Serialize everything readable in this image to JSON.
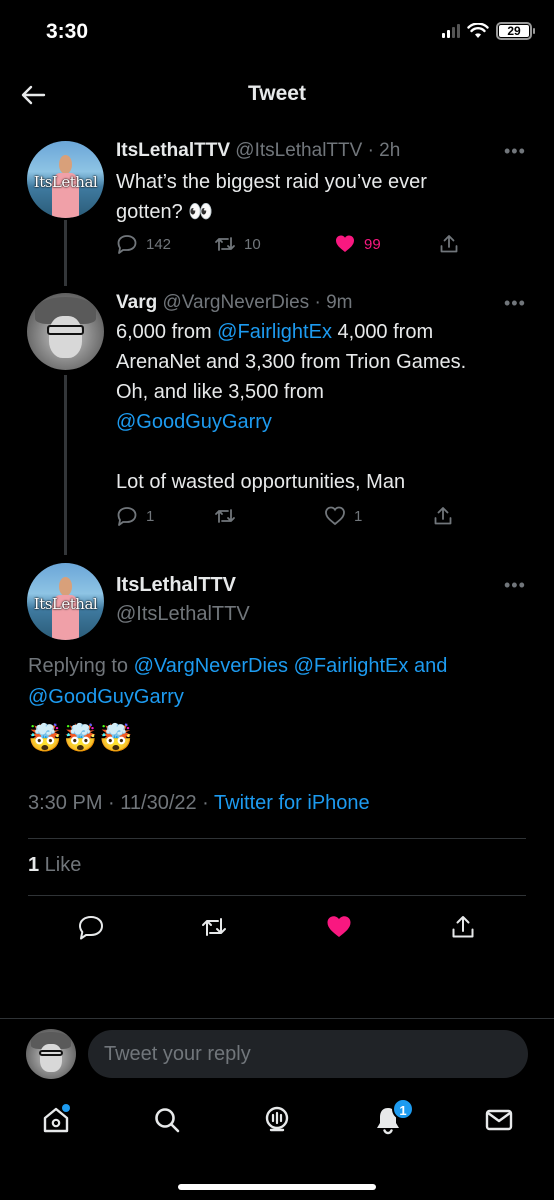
{
  "status_bar": {
    "time": "3:30",
    "battery": "29"
  },
  "header": {
    "title": "Tweet"
  },
  "tweets": [
    {
      "name": "ItsLethalTTV",
      "handle": "@ItsLethalTTV",
      "time": "· 2h",
      "avatar_text": "ItsLethal",
      "lines": [
        "What’s the biggest raid you’ve ever",
        "gotten? 👀"
      ],
      "replies": "142",
      "retweets": "10",
      "likes": "99"
    },
    {
      "name": "Varg",
      "handle": "@VargNeverDies",
      "time": "· 9m",
      "text_parts": {
        "p1": "6,000 from ",
        "m1": "@FairlightEx",
        "p2": " 4,000 from",
        "l2": "ArenaNet and 3,300 from Trion Games.",
        "l3": "Oh, and like 3,500 from",
        "m2": "@GoodGuyGarry",
        "l5": "Lot of wasted opportunities, Man"
      },
      "replies": "1",
      "likes": "1"
    }
  ],
  "main_tweet": {
    "name": "ItsLethalTTV",
    "handle": "@ItsLethalTTV",
    "avatar_text": "ItsLethal",
    "replying_prefix": "Replying to ",
    "mentions": [
      "@VargNeverDies",
      "@FairlightEx",
      "and",
      "@GoodGuyGarry"
    ],
    "emojis": "🤯🤯🤯",
    "timestamp": "3:30 PM · 11/30/22 · ",
    "source": "Twitter for iPhone",
    "like_count": "1",
    "like_label": " Like"
  },
  "reply": {
    "placeholder": "Tweet your reply"
  },
  "tab_bar": {
    "notifications_badge": "1"
  },
  "colors": {
    "accent": "#1d9bf0",
    "like": "#f91880",
    "muted": "#71767b"
  },
  "icons": [
    "back-arrow-icon",
    "reply-icon",
    "retweet-icon",
    "heart-icon",
    "share-icon",
    "home-icon",
    "search-icon",
    "spaces-icon",
    "bell-icon",
    "mail-icon"
  ]
}
